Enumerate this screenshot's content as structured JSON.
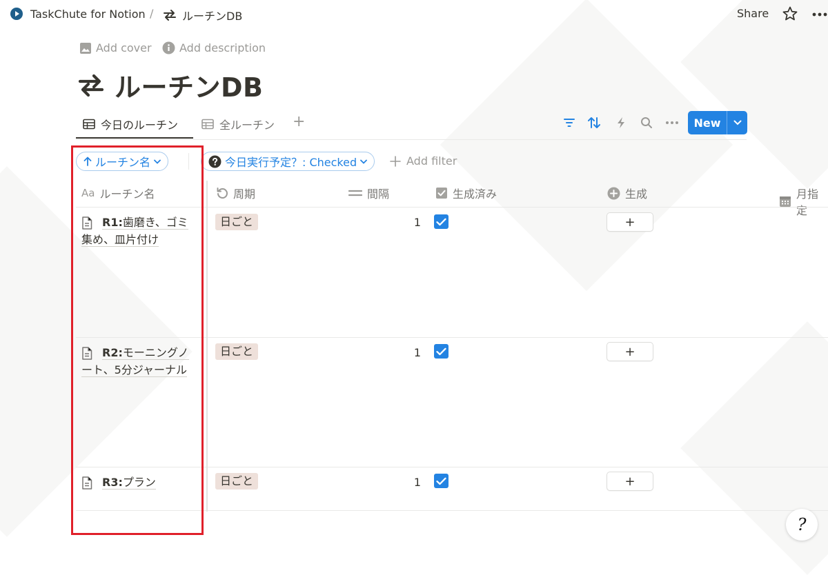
{
  "breadcrumb": {
    "workspace": "TaskChute for Notion",
    "separator": "/",
    "page": "ルーチンDB"
  },
  "topbar": {
    "share_label": "Share",
    "star_icon": "star-icon",
    "more_icon": "more-horizontal-icon"
  },
  "meta": {
    "add_cover": "Add cover",
    "add_description": "Add description"
  },
  "page_title": "ルーチンDB",
  "tabs": [
    {
      "label": "今日のルーチン",
      "active": true
    },
    {
      "label": "全ルーチン",
      "active": false
    }
  ],
  "add_view": "+",
  "toolbar": {
    "icons": [
      "filter-icon",
      "sort-icon",
      "automation-icon",
      "search-icon",
      "more-icon"
    ],
    "new_label": "New"
  },
  "filters": {
    "sort_chip": "ルーチン名",
    "filter_chip": "今日実行予定？: Checked",
    "add_filter": "Add filter"
  },
  "columns": [
    {
      "prefix": "Aa",
      "label": "ルーチン名"
    },
    {
      "label": "周期",
      "icon": "cycle-icon"
    },
    {
      "label": "間隔",
      "icon": "equals-icon"
    },
    {
      "label": "生成済み",
      "icon": "checkbox-icon"
    },
    {
      "label": "生成",
      "icon": "button-plus-icon"
    },
    {
      "label": "月指定",
      "icon": "calendar-icon"
    }
  ],
  "rows": [
    {
      "id": "R1:",
      "name": "歯磨き、ゴミ集め、皿片付け",
      "line1": "歯磨き、ゴミ",
      "line2": "集め、皿片付け",
      "cycle": "日ごと",
      "interval": "1",
      "generated": true,
      "generate_button": "+"
    },
    {
      "id": "R2:",
      "name": "モーニングノート、5分ジャーナル",
      "line1": "モーニングノ",
      "line2": "ート、5分ジャーナル",
      "cycle": "日ごと",
      "interval": "1",
      "generated": true,
      "generate_button": "+"
    },
    {
      "id": "R3:",
      "name": "プラン",
      "line1": "プラン",
      "line2": "",
      "cycle": "日ごと",
      "interval": "1",
      "generated": true,
      "generate_button": "+"
    }
  ],
  "help_button": "?",
  "colors": {
    "accent": "#2383e2",
    "tag_bg": "#eee0da",
    "highlight_box": "#e0202a"
  }
}
